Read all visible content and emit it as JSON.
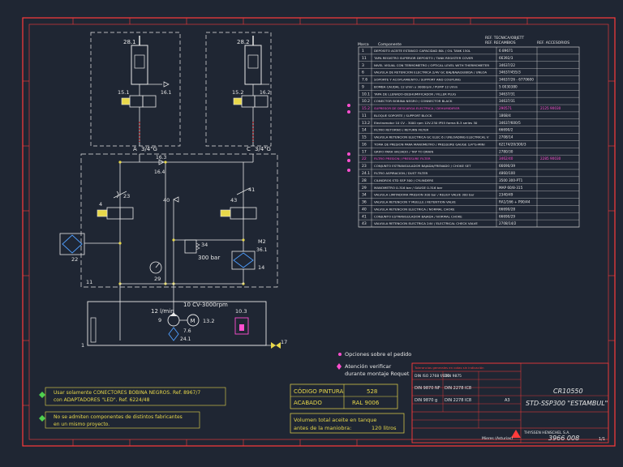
{
  "schematic": {
    "cylinder_left": "28.1",
    "cylinder_right": "28.2",
    "valve_left": "15.1",
    "valve_right": "15.2",
    "check_left": "16.1",
    "check_right": "16.2",
    "port_a": "A",
    "port_c": "C",
    "port_a_size": "3/4\"G",
    "port_c_size": "3/4\"G",
    "node_16_3": "16.3",
    "node_16_4": "16.4",
    "valve_4": "4",
    "throttle_23": "23",
    "valve_43": "43",
    "throttle_41": "41",
    "node_40": "40",
    "relief_34": "34",
    "relief_pressure": "300 bar",
    "filter_22": "22",
    "filter_14": "14",
    "m2": "M2",
    "node_36_1": "36.1",
    "gauge_29": "29",
    "block_11": "11",
    "pump_rate": "12 l/min",
    "motor_spec": "10 CV-3000rpm",
    "pump_9": "9",
    "motor_m": "M",
    "motor_13_2": "13.2",
    "label_7_6": "7.6",
    "label_24_1": "24.1",
    "label_10_3": "10.3",
    "label_1": "1",
    "label_17": "17"
  },
  "parts_table": {
    "header_ref_tecnica": "REF. TECNICA/OBJETT",
    "header_ref_recambio": "REF. RECAMBIOS",
    "header_ref_accesorios": "REF. ACCESORIOS",
    "col_marca": "Marca",
    "col_componente": "Componente",
    "rows": [
      {
        "id": "1",
        "desc": "DEPOSITO ACEITE ESTANCO CAPACIDAD 80L / OIL TANK 150L",
        "ref": "6 89671",
        "acc": "",
        "hl": false
      },
      {
        "id": "11",
        "desc": "TAPA REGISTRO SUPERIOR DEPOSITO / TANK REGISTER COVER",
        "ref": "66392/3",
        "acc": "",
        "hl": false
      },
      {
        "id": "3",
        "desc": "NIVEL VISUAL CON TERMOMETRO / OPTICAL LEVEL WITH THERMOMETER",
        "ref": "34637/22",
        "acc": "",
        "hl": false
      },
      {
        "id": "6",
        "desc": "VALVULA DE RETENCION ELECTRICA 2/4V GC BAJ/BAJA/SUBIDA / UNLOADING ELECTRICAL VALVE 2/4 GC",
        "ref": "34637/455/3",
        "acc": "",
        "hl": false
      },
      {
        "id": "7.6",
        "desc": "SOPORTE Y ACOPLAMIENTO / SUPPORT AND COUPLING",
        "ref": "34637/26 - 6770600",
        "acc": "",
        "hl": false
      },
      {
        "id": "9",
        "desc": "BOMBA CAUDAL 12 l/min y 3000rpm / PUMP 12 l/min",
        "ref": "5 0030380",
        "acc": "",
        "hl": false
      },
      {
        "id": "10.1",
        "desc": "TAPA DE LLENADO-DESHUMIFICADOR / FILLER PLUG",
        "ref": "34637/31",
        "acc": "",
        "hl": false
      },
      {
        "id": "10.2",
        "desc": "CONECTOR BOBINA NEGRO / CONNECTOR BLACK",
        "ref": "34637/31",
        "acc": "",
        "hl": false
      },
      {
        "id": "15.2",
        "desc": "SUPRESOR DE DESCARGA ELECTRICA / DEHUMIDIFIER",
        "ref": "290571",
        "acc": "2125 90030",
        "hl": true
      },
      {
        "id": "11",
        "desc": "BLOQUE SOPORTE / SUPPORT BLOCK",
        "ref": "1868/4",
        "acc": "",
        "hl": false
      },
      {
        "id": "13.2",
        "desc": "Electromotor 10 CV - 3000 rpm 12V-230 IP55 forma B-3 series 300 / CUSTOM 10 hp",
        "ref": "34637/600/5",
        "acc": "",
        "hl": false
      },
      {
        "id": "14",
        "desc": "FILTRO RETORNO / RETURN FILTER",
        "ref": "66690/2",
        "acc": "",
        "hl": false
      },
      {
        "id": "15",
        "desc": "VALVULA RETENCION ELECTRICA GC ELEC 6 / UNLOADING ELECTRICAL VALVE GC 6",
        "ref": "2708/14",
        "acc": "",
        "hl": false
      },
      {
        "id": "16",
        "desc": "TOMA DE PRESION PARA MANOMETRO / PRESSURE GAUGE 1/4\"G-MINI",
        "ref": "62174/20/300/3",
        "acc": "",
        "hl": false
      },
      {
        "id": "17",
        "desc": "GRIFO PARA VACIADO / TAP TO DRAIN",
        "ref": "2780/30",
        "acc": "",
        "hl": false
      },
      {
        "id": "22",
        "desc": "FILTRO PRESION / PRESSURE FILTER",
        "ref": "3462/40",
        "acc": "2285 90030",
        "hl": true
      },
      {
        "id": "23",
        "desc": "CONJUNTO ESTRANGULADOR BAJADA/FRENADO / CHOKE SET",
        "ref": "66690/39",
        "acc": "",
        "hl": false
      },
      {
        "id": "24.1",
        "desc": "FILTRO ASPIRACION / DUST FILTER",
        "ref": "4860/100",
        "acc": "",
        "hl": false
      },
      {
        "id": "28",
        "desc": "CILINDROS STD SSP 300 / CYLINDERS",
        "ref": "3500 300-PT1",
        "acc": "",
        "hl": false
      },
      {
        "id": "29",
        "desc": "MANOMETRO 0-316 bar / GAUGE 0-316 bar",
        "ref": "MAP 60/8-315",
        "acc": "",
        "hl": false
      },
      {
        "id": "34",
        "desc": "VALVULA LIMITADORA PRESION 300 bar / RELIEF VALVE 300 bar",
        "ref": "2340/49",
        "acc": "",
        "hl": false
      },
      {
        "id": "36",
        "desc": "VALVULA RETENCION Y MUELLE / RETENTION VALVE",
        "ref": "RA1/166 + P90/44",
        "acc": "",
        "hl": false
      },
      {
        "id": "40",
        "desc": "VALVULA RETENCION ELECTRICA / NORMAL CHOKE",
        "ref": "66690/28",
        "acc": "",
        "hl": false
      },
      {
        "id": "41",
        "desc": "CONJUNTO ESTRANGULADOR BAJADA / NORMAL CHOKE",
        "ref": "66690/29",
        "acc": "",
        "hl": false
      },
      {
        "id": "43",
        "desc": "VALVULA RETENCION ELECTRICA 24V / ELECTRICAL CHECK VALVE",
        "ref": "2708/14/2",
        "acc": "",
        "hl": false
      }
    ]
  },
  "notes": {
    "optional": "Opciones sobre el pedido",
    "verify": "Atención verificar",
    "verify2": "durante montaje Roquet",
    "note1_line1": "Usar solamente CONECTORES BOBINA NEGROS. Ref. 8967/7",
    "note1_line2": "con ADAPTADORES \"LED\". Ref. 6224/48",
    "note2_line1": "No se admiten componentes de distintos fabricantes",
    "note2_line2": "en un mismo proyecto."
  },
  "paint": {
    "label_code": "CÓDIGO PINTURA",
    "code_value": "528",
    "label_finish": "ACABADO",
    "finish_value": "RAL 9006"
  },
  "oil": {
    "line1": "Volumen total aceite en tanque",
    "line2": "antes de la maniobra:",
    "value": "120 litros"
  },
  "title_block": {
    "model": "CR10550",
    "name": "STD-SSP300 \"ESTAMBUL\"",
    "company": "THYSSEN HENSCHEL S.A.",
    "location": "Mieres (Asturias)",
    "drawing_no": "3966 008",
    "sheet": "1/1",
    "std_label1": "DIN ISO 2768 f/ETC",
    "std_label2": "DIN 9870 NF",
    "std_label3": "DIN 9870 g",
    "std_label4": "DIN 9875",
    "std_label5": "DIN 2278 IC8",
    "std_label6": "DIN 2278 IC8",
    "scale_label": "A3",
    "note_top": "Tolerancias generales en cotas sin indicación"
  },
  "colors": {
    "bg": "#1f2633",
    "frame": "#ff3b3b",
    "line": "#e8e8e8",
    "yellow": "#e8d84a",
    "magenta": "#ff4fd0",
    "green": "#4fd04f",
    "blue": "#4f9fff",
    "table": "#c8c8c8"
  }
}
